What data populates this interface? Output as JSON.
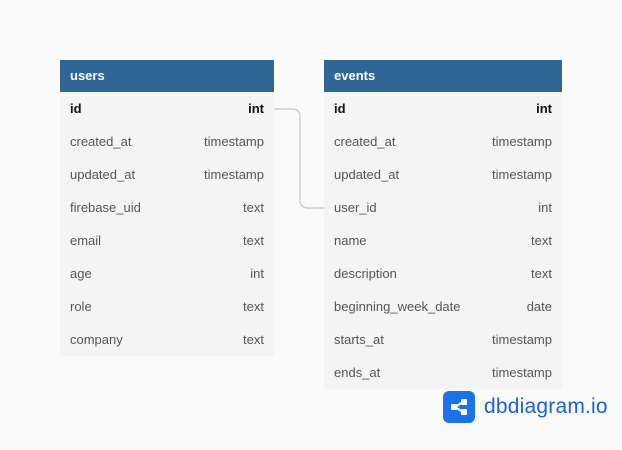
{
  "tables": {
    "users": {
      "title": "users",
      "rows": [
        {
          "name": "id",
          "type": "int",
          "pk": true
        },
        {
          "name": "created_at",
          "type": "timestamp"
        },
        {
          "name": "updated_at",
          "type": "timestamp"
        },
        {
          "name": "firebase_uid",
          "type": "text"
        },
        {
          "name": "email",
          "type": "text"
        },
        {
          "name": "age",
          "type": "int"
        },
        {
          "name": "role",
          "type": "text"
        },
        {
          "name": "company",
          "type": "text"
        }
      ]
    },
    "events": {
      "title": "events",
      "rows": [
        {
          "name": "id",
          "type": "int",
          "pk": true
        },
        {
          "name": "created_at",
          "type": "timestamp"
        },
        {
          "name": "updated_at",
          "type": "timestamp"
        },
        {
          "name": "user_id",
          "type": "int"
        },
        {
          "name": "name",
          "type": "text"
        },
        {
          "name": "description",
          "type": "text"
        },
        {
          "name": "beginning_week_date",
          "type": "date"
        },
        {
          "name": "starts_at",
          "type": "timestamp"
        },
        {
          "name": "ends_at",
          "type": "timestamp"
        }
      ]
    }
  },
  "relationship": {
    "from": "users.id",
    "to": "events.user_id"
  },
  "brand": {
    "label": "dbdiagram.io",
    "icon": "share-icon"
  },
  "colors": {
    "header": "#2f6696",
    "brand": "#1a73e8",
    "connector": "#c4c4c4"
  }
}
